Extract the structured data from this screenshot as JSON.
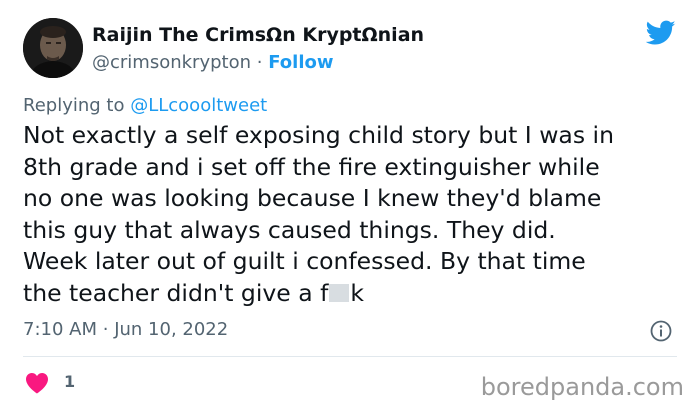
{
  "author": {
    "display_name": "Raijin The CrimsΩn KryptΩnian",
    "handle": "@crimsonkrypton",
    "separator": "·",
    "follow_label": "Follow"
  },
  "reply": {
    "prefix": "Replying to",
    "mention": "@LLcoooltweet"
  },
  "body": {
    "lines": [
      "Not exactly a self exposing child story but I was in",
      "8th grade and i set off the fire extinguisher while",
      "no one was looking because I knew they'd blame",
      "this guy that always caused things. They did.",
      "Week later out of guilt i confessed. By that time"
    ],
    "last_line_start": "the teacher didn't give a f",
    "last_line_end": "k"
  },
  "meta": {
    "time": "7:10 AM",
    "separator": "·",
    "date": "Jun 10, 2022"
  },
  "actions": {
    "like_count": "1"
  },
  "watermark": "boredpanda.com",
  "colors": {
    "twitter_blue": "#1d9bf0",
    "like_pink": "#f91880",
    "text": "#0f1419",
    "secondary": "#536471"
  },
  "icons": {
    "brand": "twitter-bird-icon",
    "info": "info-icon",
    "like": "heart-icon"
  }
}
